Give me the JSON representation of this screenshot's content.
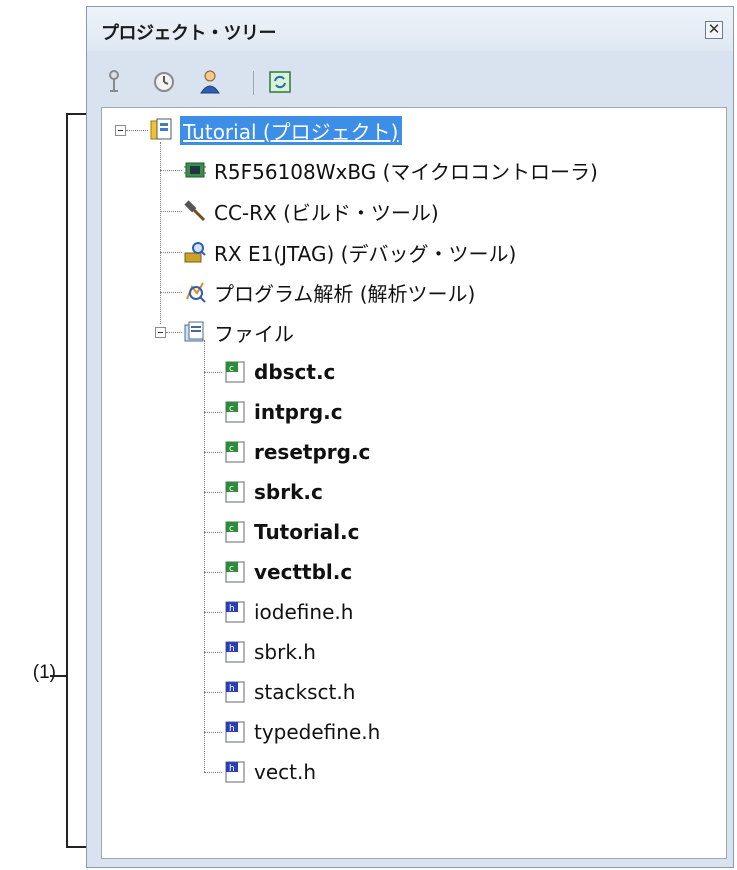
{
  "callout": {
    "label": "(1)"
  },
  "panel": {
    "title": "プロジェクト・ツリー",
    "close_glyph": "✕"
  },
  "toolbar": {
    "buttons": [
      {
        "icon": "pin-icon"
      },
      {
        "icon": "clock-icon"
      },
      {
        "icon": "person-icon"
      },
      {
        "icon": "refresh-icon"
      }
    ]
  },
  "tree": {
    "project": {
      "label": "Tutorial (プロジェクト)",
      "icon": "project-icon",
      "expanded": true,
      "selected": true
    },
    "nodes": [
      {
        "label": "R5F56108WxBG (マイクロコントローラ)",
        "icon": "microcontroller-icon"
      },
      {
        "label": "CC-RX (ビルド・ツール)",
        "icon": "hammer-icon"
      },
      {
        "label": "RX E1(JTAG) (デバッグ・ツール)",
        "icon": "debug-tool-icon"
      },
      {
        "label": "プログラム解析 (解析ツール)",
        "icon": "analysis-icon"
      },
      {
        "label": "ファイル",
        "icon": "folder-icon",
        "expanded": true
      }
    ],
    "files": [
      {
        "label": "dbsct.c",
        "type": "c",
        "bold": true
      },
      {
        "label": "intprg.c",
        "type": "c",
        "bold": true
      },
      {
        "label": "resetprg.c",
        "type": "c",
        "bold": true
      },
      {
        "label": "sbrk.c",
        "type": "c",
        "bold": true
      },
      {
        "label": "Tutorial.c",
        "type": "c",
        "bold": true
      },
      {
        "label": "vecttbl.c",
        "type": "c",
        "bold": true
      },
      {
        "label": "iodefine.h",
        "type": "h",
        "bold": false
      },
      {
        "label": "sbrk.h",
        "type": "h",
        "bold": false
      },
      {
        "label": "stacksct.h",
        "type": "h",
        "bold": false
      },
      {
        "label": "typedefine.h",
        "type": "h",
        "bold": false
      },
      {
        "label": "vect.h",
        "type": "h",
        "bold": false
      }
    ]
  },
  "colors": {
    "selection": "#3d8ee6",
    "panel_bg": "#d8e3ef",
    "c_file": "#2e8b3a",
    "h_file": "#2b3fb5"
  }
}
